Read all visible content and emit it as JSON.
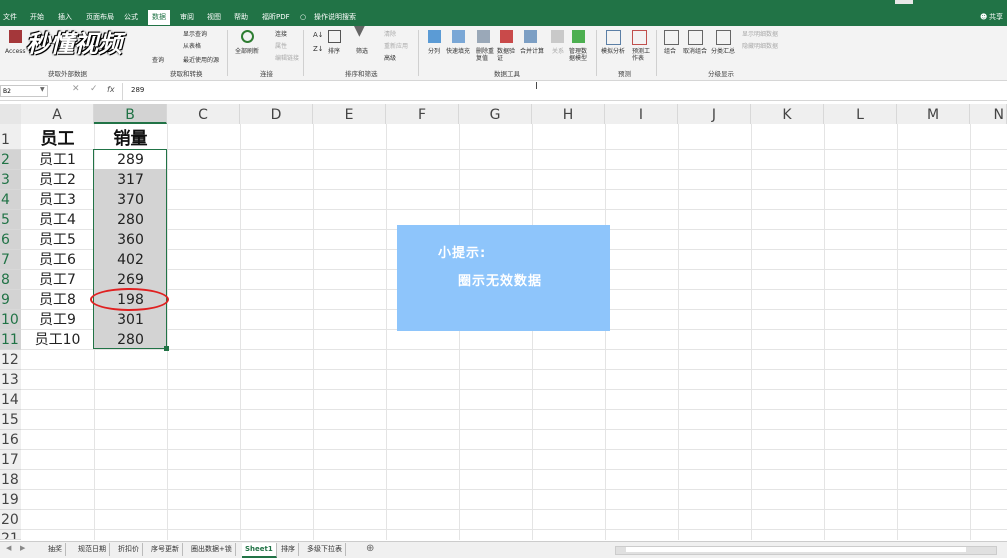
{
  "menu": [
    "文件",
    "开始",
    "插入",
    "页面布局",
    "公式",
    "数据",
    "审阅",
    "视图",
    "帮助",
    "福昕PDF",
    "操作说明搜索"
  ],
  "active_menu": "数据",
  "share": "共享",
  "watermark": "秒懂视频",
  "ribbon": {
    "access": "Access",
    "show_query": "显示查询",
    "from_table": "从表格",
    "query": "查询",
    "recent_source": "最近使用的源",
    "refresh_all": "全部刷新",
    "connections": "连接",
    "properties": "属性",
    "edit_links": "编辑链接",
    "sort": "排序",
    "filter": "筛选",
    "clear": "清除",
    "reapply": "重新应用",
    "advanced": "高级",
    "text_to_columns": "分列",
    "flash_fill": "快速填充",
    "remove_duplicates": "删除重复值",
    "data_validation": "数据验证",
    "consolidate": "合并计算",
    "relationships": "关系",
    "data_model": "管理数据模型",
    "what_if": "模拟分析",
    "forecast_sheet": "预测工作表",
    "group": "组合",
    "ungroup": "取消组合",
    "subtotal": "分类汇总",
    "show_detail": "显示明细数据",
    "hide_detail": "隐藏明细数据",
    "groups": {
      "get_external": "获取外部数据",
      "get_transform": "获取和转换",
      "connections": "连接",
      "sort_filter": "排序和筛选",
      "data_tools": "数据工具",
      "forecast": "预测",
      "outline": "分级显示"
    }
  },
  "formula_bar": {
    "name_box": "B2",
    "value": "289"
  },
  "columns": [
    "A",
    "B",
    "C",
    "D",
    "E",
    "F",
    "G",
    "H",
    "I",
    "J",
    "K",
    "L",
    "M",
    "N"
  ],
  "rows": [
    "1",
    "2",
    "3",
    "4",
    "5",
    "6",
    "7",
    "8",
    "9",
    "10",
    "11",
    "12",
    "13",
    "14",
    "15",
    "16",
    "17",
    "18",
    "19",
    "20",
    "21"
  ],
  "table": {
    "header": [
      "员工",
      "销量"
    ],
    "employees": [
      "员工1",
      "员工2",
      "员工3",
      "员工4",
      "员工5",
      "员工6",
      "员工7",
      "员工8",
      "员工9",
      "员工10"
    ],
    "sales": [
      "289",
      "317",
      "370",
      "280",
      "360",
      "402",
      "269",
      "198",
      "301",
      "280"
    ]
  },
  "tip": {
    "title": "小提示:",
    "text": "圈示无效数据"
  },
  "sheet_tabs": [
    "抽奖",
    "规范日期",
    "折扣价",
    "序号更新",
    "圈出数据+锁",
    "Sheet1",
    "排序",
    "多级下拉表"
  ],
  "active_sheet": "Sheet1",
  "colors": {
    "excel_green": "#217346",
    "tip_bg": "#8ec5fb",
    "circle": "#e02020"
  }
}
